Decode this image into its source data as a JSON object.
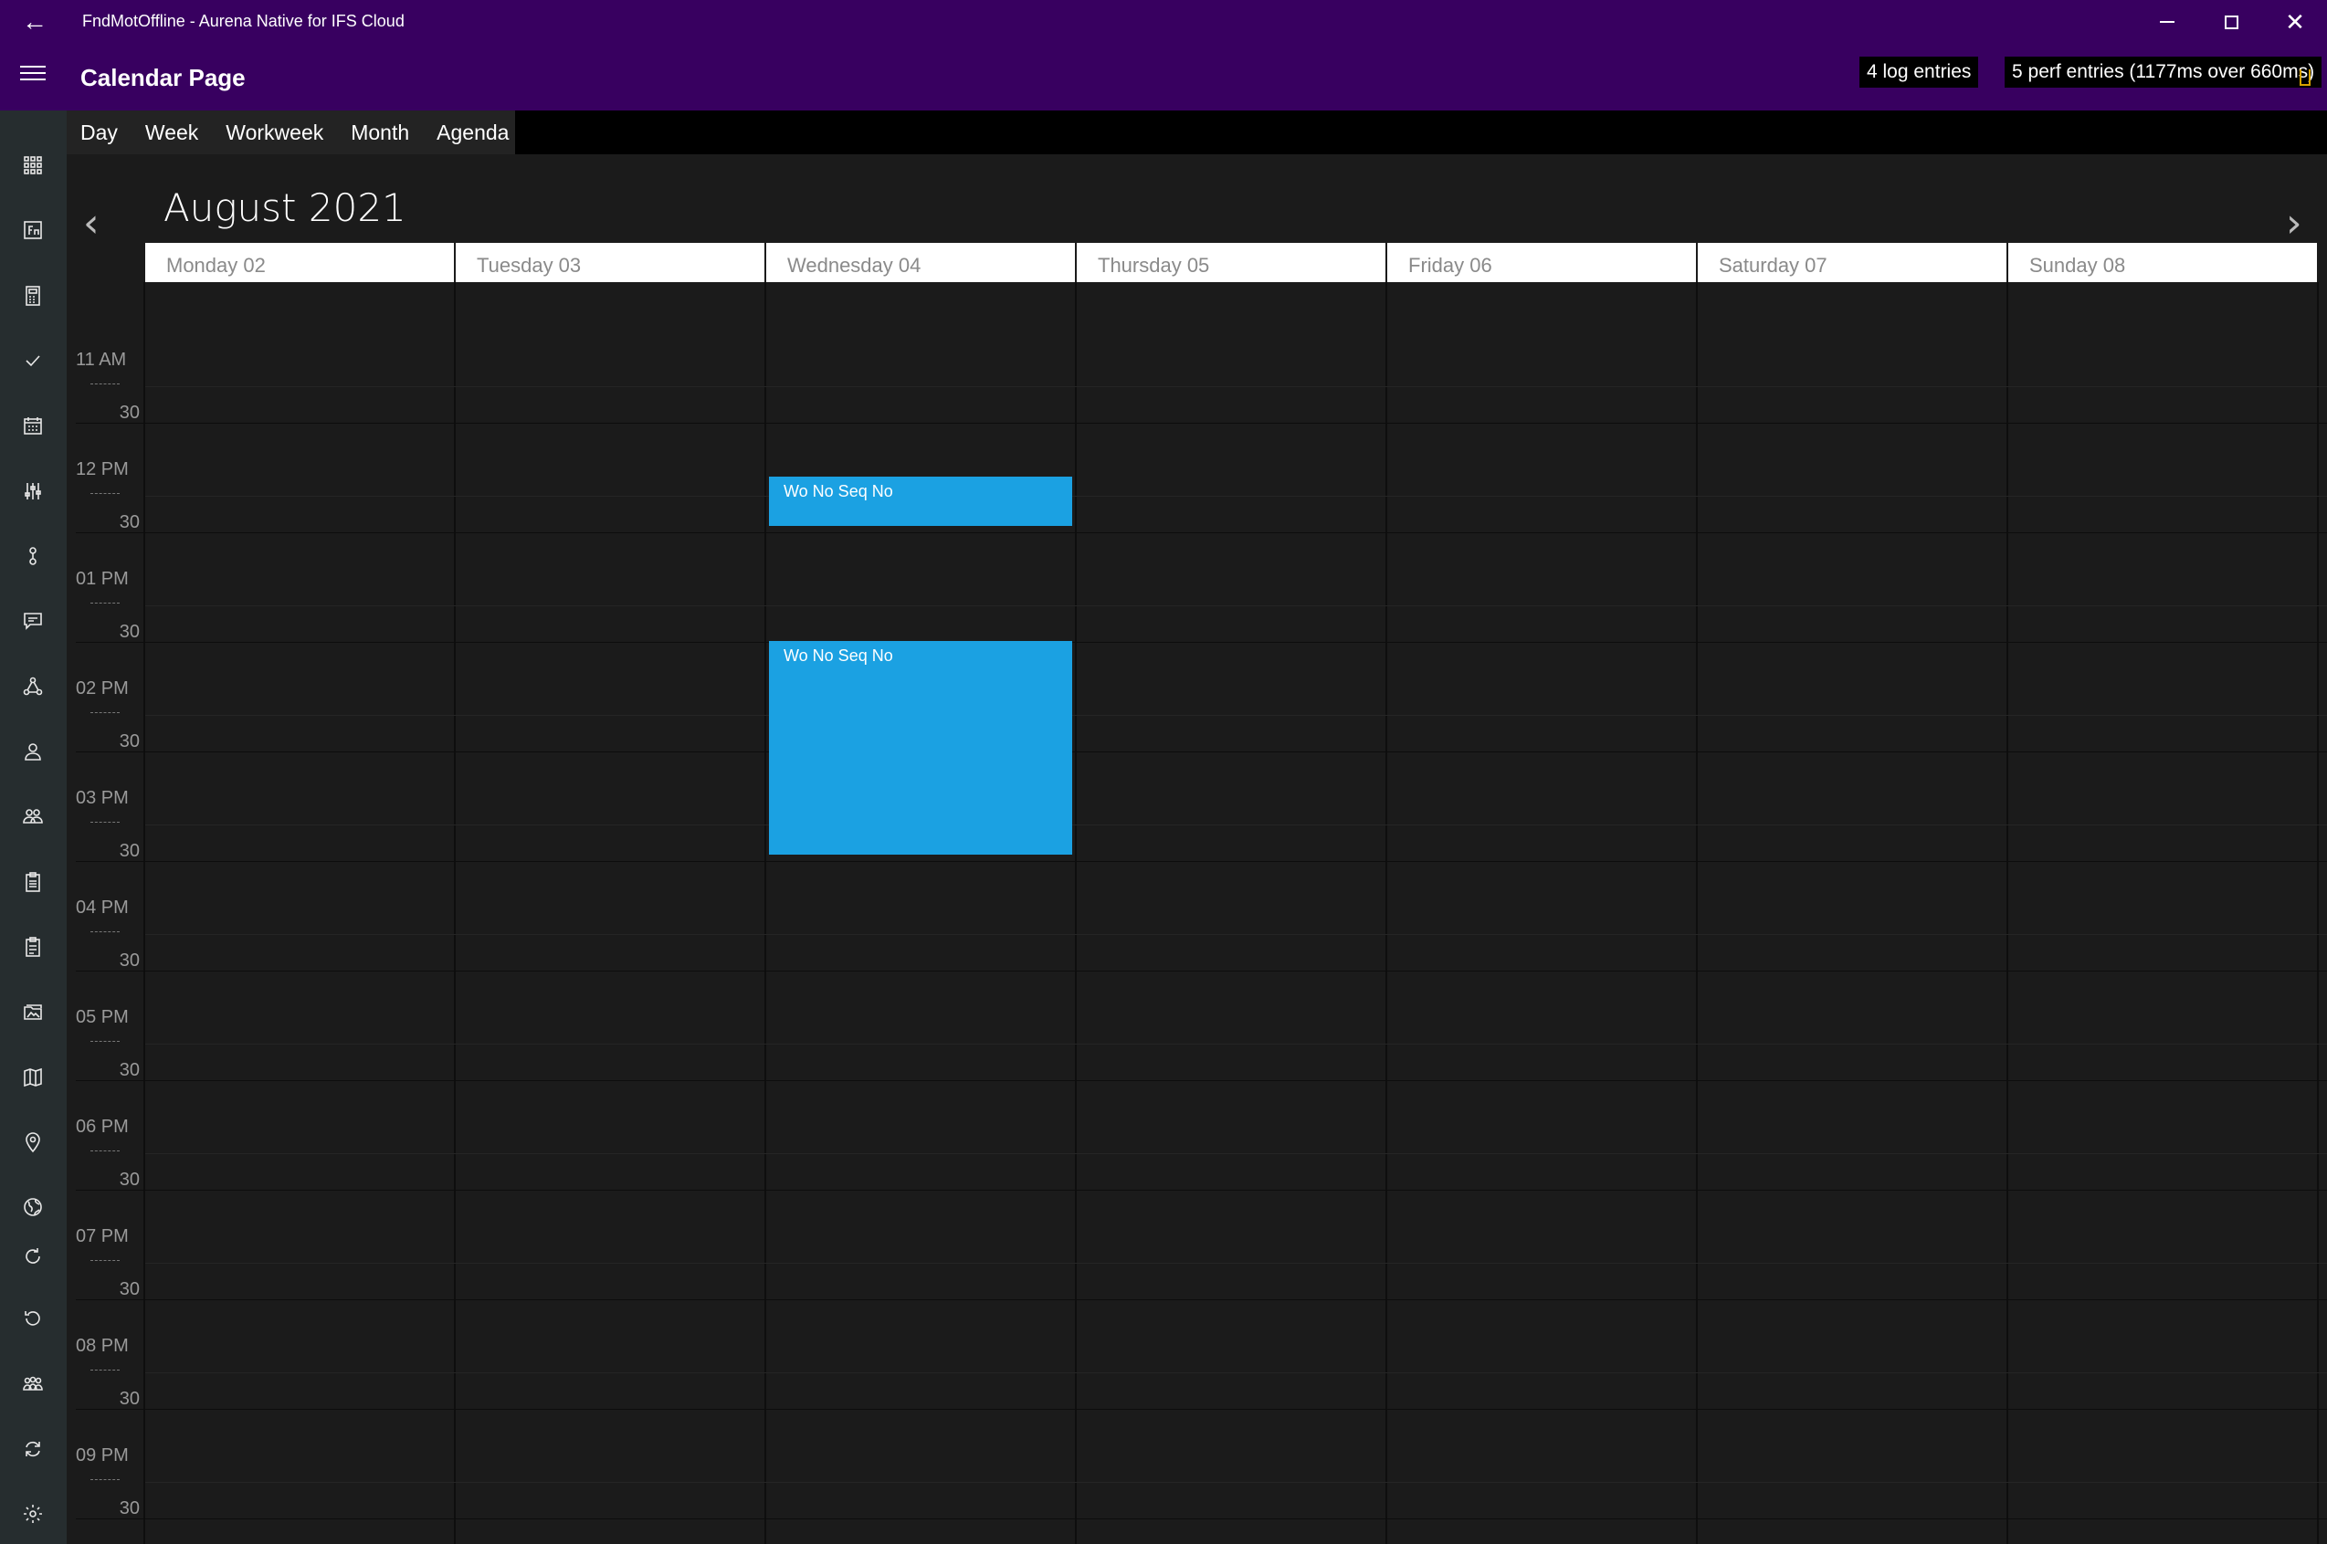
{
  "window": {
    "title": "FndMotOffline - Aurena Native for IFS Cloud",
    "back_icon": "back-arrow-icon",
    "controls": [
      "minimize-icon",
      "maximize-icon",
      "close-icon"
    ],
    "close_glyph": "✕"
  },
  "header": {
    "page_title": "Calendar Page",
    "log_entries": "4 log entries",
    "perf_entries": "5 perf entries (1177ms over 660ms)"
  },
  "rail": {
    "icons": [
      "apps-grid-icon",
      "function-icon",
      "calculator-icon",
      "checkmark-icon",
      "calendar-icon",
      "sliders-icon",
      "route-icon",
      "chat-icon",
      "network-icon",
      "person-icon",
      "group-icon",
      "clipboard-icon",
      "checklist-icon",
      "folder-image-icon",
      "map-icon",
      "location-pin-icon",
      "globe-icon",
      "refresh-icon",
      "history-icon",
      "team-icon",
      "sync-icon",
      "gear-icon"
    ]
  },
  "tabs": [
    "Day",
    "Week",
    "Workweek",
    "Month",
    "Agenda"
  ],
  "calendar": {
    "month": "August 2021",
    "prev_glyph": "‹",
    "next_glyph": "›",
    "days": [
      "Monday 02",
      "Tuesday 03",
      "Wednesday 04",
      "Thursday 05",
      "Friday 06",
      "Saturday 07",
      "Sunday 08"
    ],
    "hours": [
      "11 AM",
      "12 PM",
      "01 PM",
      "02 PM",
      "03 PM",
      "04 PM",
      "05 PM",
      "06 PM",
      "07 PM",
      "08 PM",
      "09 PM"
    ],
    "half_label": "30",
    "events": [
      {
        "title": "Wo No Seq No",
        "day": "Wednesday 04",
        "start": "12:30",
        "end": "13:00"
      },
      {
        "title": "Wo No Seq No",
        "day": "Wednesday 04",
        "start": "14:00",
        "end": "16:00"
      }
    ],
    "accent_color": "#1ba1e2",
    "titlebar_color": "#380060"
  }
}
